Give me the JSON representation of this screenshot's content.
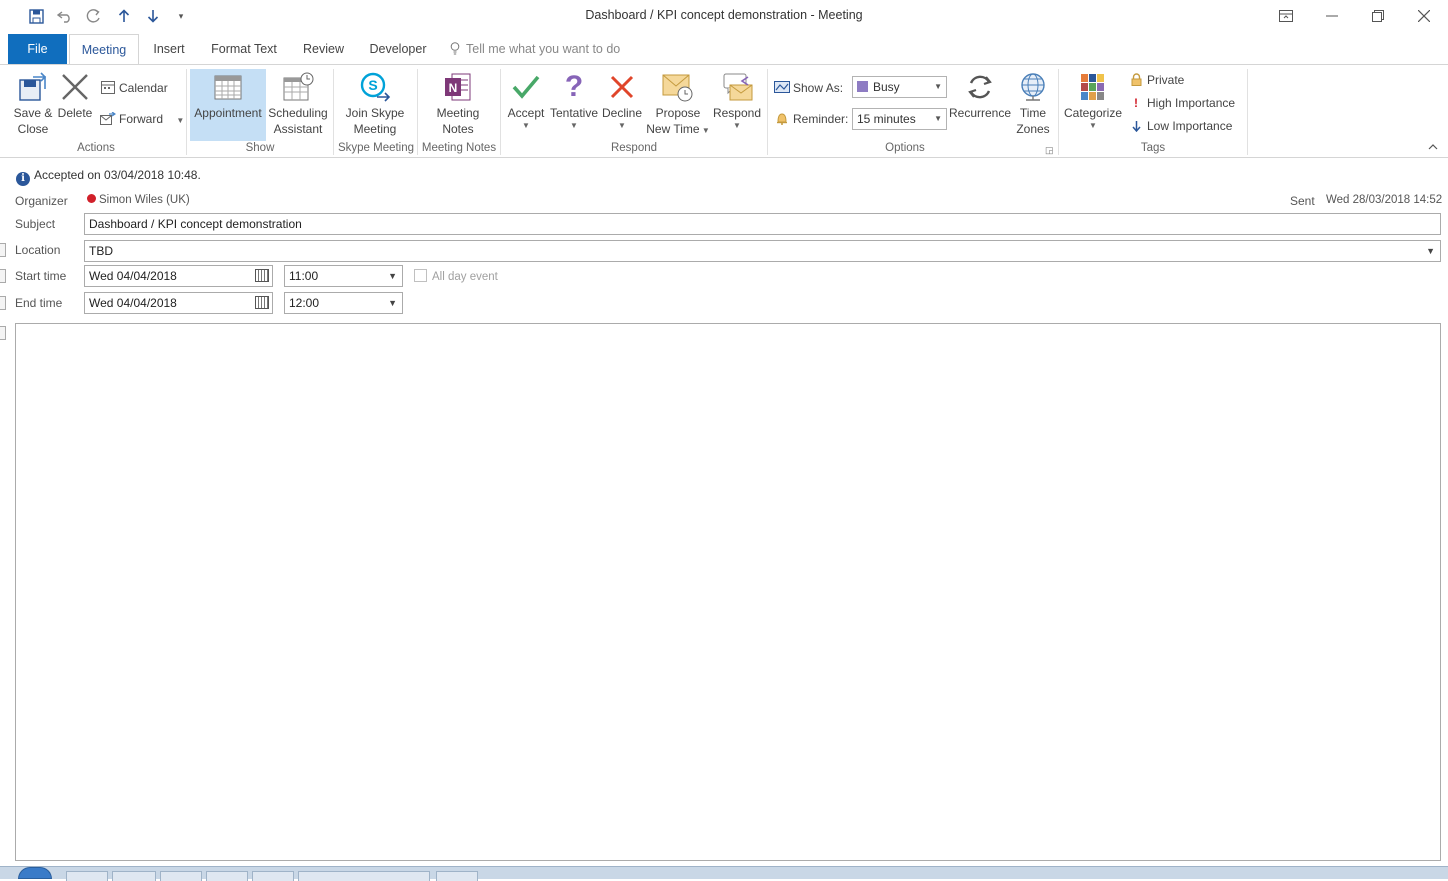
{
  "window": {
    "title": "Dashboard / KPI concept demonstration  -  Meeting",
    "quick_access": [
      "save-icon",
      "undo-icon",
      "redo-icon",
      "up-arrow-icon",
      "down-arrow-icon",
      "customize-icon"
    ],
    "controls": [
      "ribbon-display-icon",
      "minimize-icon",
      "restore-icon",
      "close-icon"
    ]
  },
  "tabs": [
    {
      "label": "File"
    },
    {
      "label": "Meeting"
    },
    {
      "label": "Insert"
    },
    {
      "label": "Format Text"
    },
    {
      "label": "Review"
    },
    {
      "label": "Developer"
    }
  ],
  "tell_me": "Tell me what you want to do",
  "ribbon": {
    "actions": {
      "group": "Actions",
      "save_close": [
        "Save &",
        "Close"
      ],
      "delete": "Delete",
      "calendar": "Calendar",
      "forward": "Forward"
    },
    "show": {
      "group": "Show",
      "appointment": "Appointment",
      "scheduling": [
        "Scheduling",
        "Assistant"
      ]
    },
    "skype": {
      "group": "Skype Meeting",
      "join": [
        "Join Skype",
        "Meeting"
      ]
    },
    "notes": {
      "group": "Meeting Notes",
      "notes": [
        "Meeting",
        "Notes"
      ]
    },
    "respond": {
      "group": "Respond",
      "accept": "Accept",
      "tentative": "Tentative",
      "decline": "Decline",
      "propose": [
        "Propose",
        "New Time"
      ],
      "respond": "Respond"
    },
    "options": {
      "group": "Options",
      "show_as_label": "Show As:",
      "show_as_value": "Busy",
      "reminder_label": "Reminder:",
      "reminder_value": "15 minutes",
      "recurrence": "Recurrence",
      "timezones": [
        "Time",
        "Zones"
      ],
      "busy_color": "#8e7cc3"
    },
    "tags": {
      "group": "Tags",
      "categorize": "Categorize",
      "private": "Private",
      "high": "High Importance",
      "low": "Low Importance"
    }
  },
  "info_bar": "Accepted on 03/04/2018 10:48.",
  "form": {
    "organizer_label": "Organizer",
    "organizer_value": "Simon Wiles (UK)",
    "sent_label": "Sent",
    "sent_value": "Wed 28/03/2018 14:52",
    "subject_label": "Subject",
    "subject_value": "Dashboard / KPI concept demonstration",
    "location_label": "Location",
    "location_value": "TBD",
    "start_label": "Start time",
    "start_date": "Wed 04/04/2018",
    "start_time": "11:00",
    "end_label": "End time",
    "end_date": "Wed 04/04/2018",
    "end_time": "12:00",
    "all_day": "All day event"
  },
  "colors": {
    "accent": "#2b579a",
    "file_tab": "#106ebe",
    "selected": "#c5dff5",
    "presence": "#d1202a"
  }
}
